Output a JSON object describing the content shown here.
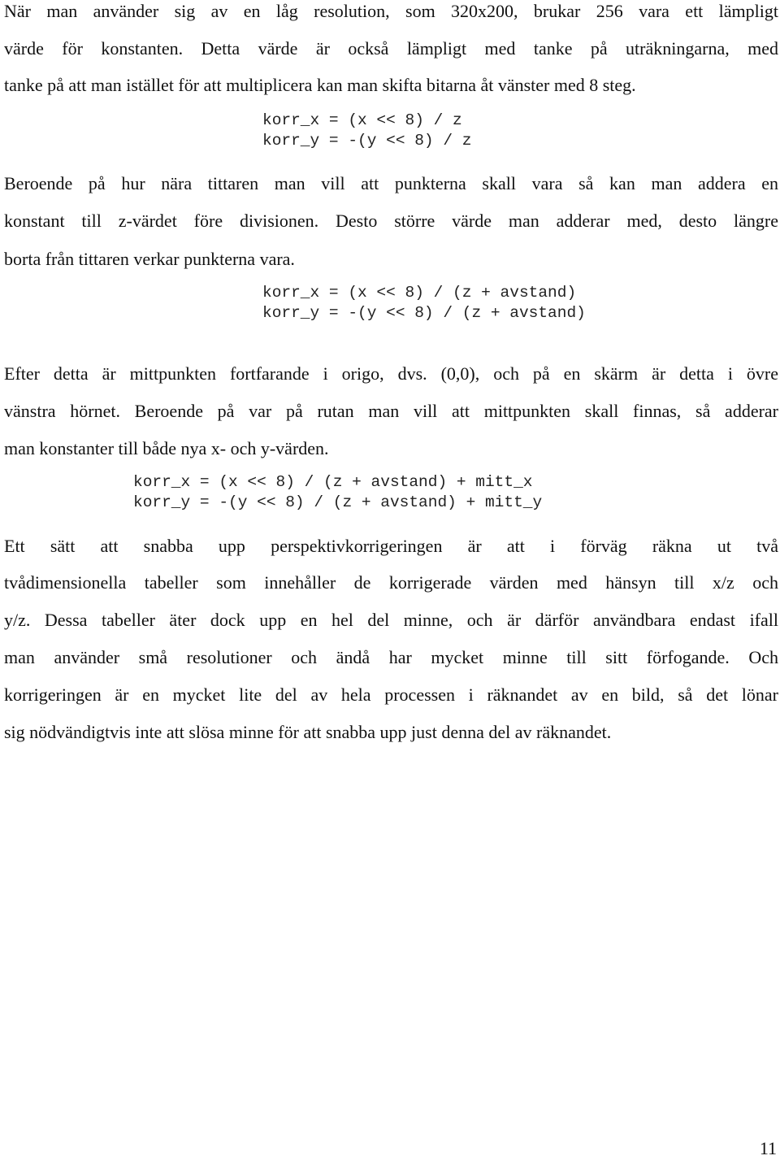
{
  "paragraphs": {
    "p1": [
      "När man använder sig av en låg resolution, som 320x200, brukar 256 vara ett lämpligt",
      "värde för konstanten. Detta värde är också lämpligt med tanke på uträkningarna, med",
      "tanke på att man istället för att multiplicera kan man skifta bitarna åt vänster med 8 steg."
    ],
    "p2": [
      "Beroende på hur nära tittaren man vill att punkterna skall vara så kan man addera en",
      "konstant till z-värdet före divisionen. Desto större värde man adderar med, desto längre",
      "borta från tittaren verkar punkterna vara."
    ],
    "p3": [
      "Efter detta är mittpunkten fortfarande i origo, dvs. (0,0), och på en skärm är detta i övre",
      "vänstra hörnet. Beroende på var på rutan man vill att mittpunkten skall finnas, så adderar",
      "man konstanter till både nya x- och y-värden."
    ],
    "p4": [
      "Ett sätt att snabba upp perspektivkorrigeringen är att i förväg räkna ut två",
      "tvådimensionella tabeller som innehåller de korrigerade värden med hänsyn till x/z och",
      "y/z. Dessa tabeller äter dock upp en hel del minne, och är därför användbara endast ifall",
      "man använder små resolutioner och ändå har mycket minne till sitt förfogande. Och",
      "korrigeringen är en mycket lite del av hela processen i räknandet av en bild, så det lönar",
      "sig nödvändigtvis inte att slösa minne för att snabba upp just denna del av räknandet."
    ]
  },
  "code": {
    "c1": [
      "korr_x = (x << 8) / z",
      "korr_y = -(y << 8) / z"
    ],
    "c2": [
      "korr_x = (x << 8) / (z + avstand)",
      "korr_y = -(y << 8) / (z + avstand)"
    ],
    "c3": [
      "korr_x = (x << 8) / (z + avstand) + mitt_x",
      "korr_y = -(y << 8) / (z + avstand) + mitt_y"
    ]
  },
  "page_number": "11"
}
